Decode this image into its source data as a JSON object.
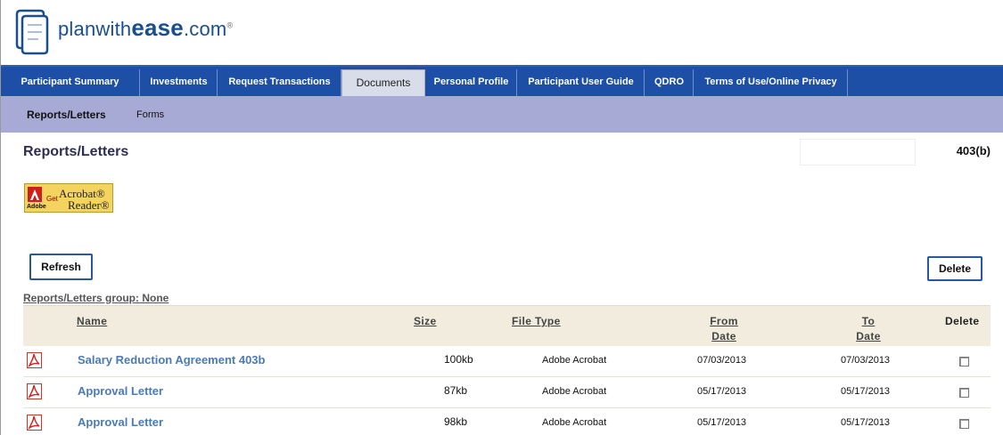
{
  "brand": {
    "prefix": "planwith",
    "bold": "ease",
    "suffix": ".com",
    "reg": "®"
  },
  "nav": {
    "tabs": [
      {
        "label": "Participant Summary"
      },
      {
        "label": "Investments"
      },
      {
        "label": "Request Transactions"
      },
      {
        "label": "Documents"
      },
      {
        "label": "Personal Profile"
      },
      {
        "label": "Participant User Guide"
      },
      {
        "label": "QDRO"
      },
      {
        "label": "Terms of Use/Online Privacy"
      }
    ]
  },
  "subnav": {
    "items": [
      {
        "label": "Reports/Letters"
      },
      {
        "label": "Forms"
      }
    ]
  },
  "page": {
    "title": "Reports/Letters",
    "plan_type": "403(b)"
  },
  "acrobat_badge": {
    "adobe": "Adobe",
    "get": "Get",
    "line1": "Acrobat®",
    "line2": "Reader®"
  },
  "actions": {
    "refresh": "Refresh",
    "delete": "Delete"
  },
  "group_label": "Reports/Letters group: None",
  "table": {
    "headers": {
      "name": "Name",
      "size": "Size",
      "file_type": "File Type",
      "from_1": "From",
      "from_2": "Date",
      "to_1": "To",
      "to_2": "Date",
      "delete": "Delete"
    },
    "rows": [
      {
        "name": "Salary Reduction Agreement 403b",
        "size": "100kb",
        "type": "Adobe Acrobat",
        "from": "07/03/2013",
        "to": "07/03/2013"
      },
      {
        "name": "Approval Letter",
        "size": "87kb",
        "type": "Adobe Acrobat",
        "from": "05/17/2013",
        "to": "05/17/2013"
      },
      {
        "name": "Approval Letter",
        "size": "98kb",
        "type": "Adobe Acrobat",
        "from": "05/17/2013",
        "to": "05/17/2013"
      }
    ]
  },
  "colors": {
    "nav_bg": "#1c4fa5",
    "subnav_bg": "#a8aad6",
    "link": "#4a7ab8",
    "header_row": "#f1ecdd"
  }
}
